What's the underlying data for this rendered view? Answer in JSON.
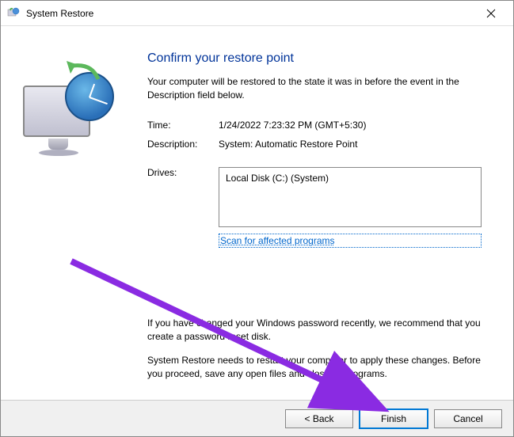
{
  "window": {
    "title": "System Restore"
  },
  "heading": "Confirm your restore point",
  "subtitle": "Your computer will be restored to the state it was in before the event in the Description field below.",
  "info": {
    "time_label": "Time:",
    "time_value": "1/24/2022 7:23:32 PM (GMT+5:30)",
    "description_label": "Description:",
    "description_value": "System: Automatic Restore Point",
    "drives_label": "Drives:",
    "drives_value": "Local Disk (C:) (System)"
  },
  "scan_link": "Scan for affected programs",
  "notices": {
    "password": "If you have changed your Windows password recently, we recommend that you create a password reset disk.",
    "restart": "System Restore needs to restart your computer to apply these changes. Before you proceed, save any open files and close all programs."
  },
  "buttons": {
    "back": "< Back",
    "finish": "Finish",
    "cancel": "Cancel"
  }
}
